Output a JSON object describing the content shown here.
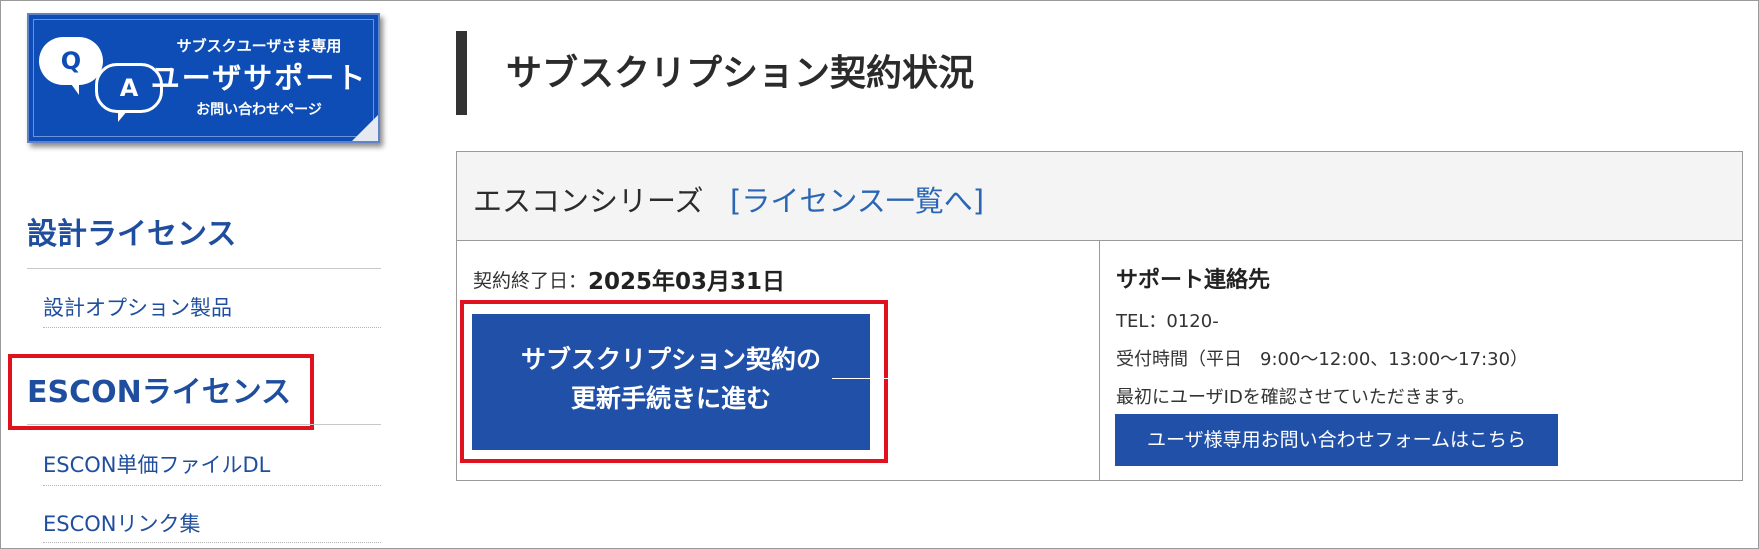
{
  "banner": {
    "subtitle_top": "サブスクユーザさま専用",
    "title": "ユーザサポート",
    "subtitle_bottom": "お問い合わせページ",
    "q_letter": "Q",
    "a_letter": "A",
    "bg_color": "#0d4db5"
  },
  "sidebar": {
    "section1_heading": "設計ライセンス",
    "section1_links": [
      "設計オプション製品"
    ],
    "section2_heading": "ESCONライセンス",
    "section2_links": [
      "ESCON単価ファイルDL",
      "ESCONリンク集"
    ],
    "link_color": "#1f4e9e",
    "highlight_color": "#e0121e"
  },
  "page": {
    "title": "サブスクリプション契約状況"
  },
  "license_table": {
    "series_name": "エスコンシリーズ",
    "license_list_link": "[ライセンス一覧へ]",
    "contract_end_label": "契約終了日：",
    "contract_end_date": "2025年03月31日",
    "renew_button_line1": "サブスクリプション契約の",
    "renew_button_line2": "更新手続きに進む",
    "support_title": "サポート連絡先",
    "support_tel": "TEL：0120-",
    "support_hours": "受付時間（平日　9:00〜12:00、13:00〜17:30）",
    "support_note": "最初にユーザIDを確認させていただきます。",
    "contact_button": "ユーザ様専用お問い合わせフォームはこちら",
    "button_color": "#2150a8"
  }
}
